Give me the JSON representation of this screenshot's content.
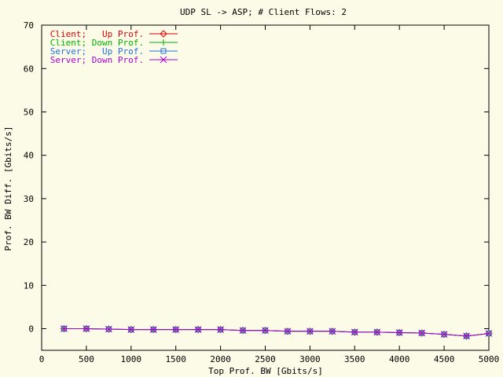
{
  "chart_data": {
    "type": "line",
    "title": "UDP SL -> ASP; # Client Flows: 2",
    "xlabel": "Top Prof. BW [Gbits/s]",
    "ylabel": "Prof. BW Diff. [Gbits/s]",
    "xlim": [
      0,
      5000
    ],
    "ylim": [
      -5,
      70
    ],
    "xticks": [
      "0",
      "500",
      "1000",
      "1500",
      "2000",
      "2500",
      "3000",
      "3500",
      "4000",
      "4500",
      "5000"
    ],
    "yticks": [
      "0",
      "10",
      "20",
      "30",
      "40",
      "50",
      "60",
      "70"
    ],
    "grid": false,
    "legend_position": "top-left",
    "x": [
      250,
      500,
      750,
      1000,
      1250,
      1500,
      1750,
      2000,
      2250,
      2500,
      2750,
      3000,
      3250,
      3500,
      3750,
      4000,
      4250,
      4500,
      4750,
      5000
    ],
    "series": [
      {
        "name": "Client;   Up Prof.",
        "color": "#e00000",
        "marker": "diamond",
        "values": [
          0,
          0,
          -0.1,
          -0.2,
          -0.2,
          -0.2,
          -0.2,
          -0.2,
          -0.4,
          -0.4,
          -0.6,
          -0.6,
          -0.6,
          -0.8,
          -0.8,
          -0.9,
          -1.0,
          -1.3,
          -1.7,
          -1.1
        ]
      },
      {
        "name": "Client; Down Prof.",
        "color": "#00b000",
        "marker": "plus",
        "values": [
          0,
          0,
          -0.1,
          -0.2,
          -0.2,
          -0.2,
          -0.2,
          -0.2,
          -0.4,
          -0.4,
          -0.6,
          -0.6,
          -0.6,
          -0.8,
          -0.8,
          -0.9,
          -1.0,
          -1.3,
          -1.7,
          -1.1
        ]
      },
      {
        "name": "Server;   Up Prof.",
        "color": "#2070e0",
        "marker": "square",
        "values": [
          0,
          0,
          -0.1,
          -0.2,
          -0.2,
          -0.2,
          -0.2,
          -0.2,
          -0.4,
          -0.4,
          -0.6,
          -0.6,
          -0.6,
          -0.8,
          -0.8,
          -0.9,
          -1.0,
          -1.3,
          -1.7,
          -1.1
        ]
      },
      {
        "name": "Server; Down Prof.",
        "color": "#b000d0",
        "marker": "cross",
        "values": [
          0,
          0,
          -0.1,
          -0.2,
          -0.2,
          -0.2,
          -0.2,
          -0.2,
          -0.4,
          -0.4,
          -0.6,
          -0.6,
          -0.6,
          -0.8,
          -0.8,
          -0.9,
          -1.0,
          -1.3,
          -1.7,
          -1.1
        ]
      }
    ]
  }
}
